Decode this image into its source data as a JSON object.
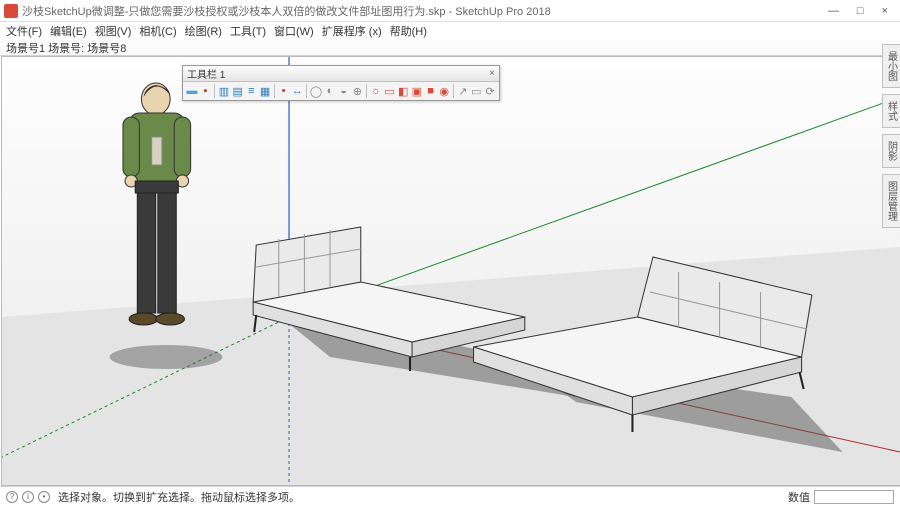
{
  "window": {
    "title": "沙枝SketchUp微调整-只做您需要沙枝授权或沙枝本人双倍的做改文件部址图用行为.skp - SketchUp Pro 2018",
    "min": "—",
    "max": "□",
    "close": "×"
  },
  "menu": {
    "items": [
      "文件(F)",
      "编辑(E)",
      "视图(V)",
      "相机(C)",
      "绘图(R)",
      "工具(T)",
      "窗口(W)",
      "扩展程序 (x)",
      "帮助(H)"
    ]
  },
  "scene": {
    "label": "场景号1  场景号:  场景号8"
  },
  "toolbar": {
    "title": "工具栏 1",
    "close": "×",
    "icons": [
      {
        "name": "tool-a",
        "color": "#4aa3df",
        "glyph": "▬"
      },
      {
        "name": "tool-b",
        "color": "#c33",
        "glyph": "▪"
      },
      {
        "sep": true
      },
      {
        "name": "tool-c",
        "color": "#2a7dbb",
        "glyph": "▥"
      },
      {
        "name": "tool-d",
        "color": "#2a7dbb",
        "glyph": "▤"
      },
      {
        "name": "tool-e",
        "color": "#2a7dbb",
        "glyph": "≡"
      },
      {
        "name": "tool-f",
        "color": "#2a7dbb",
        "glyph": "▦"
      },
      {
        "sep": true
      },
      {
        "name": "tool-g",
        "color": "#c33",
        "glyph": "•"
      },
      {
        "name": "tool-h",
        "color": "#2a7dbb",
        "glyph": "↔"
      },
      {
        "sep": true
      },
      {
        "name": "tool-i",
        "color": "#888",
        "glyph": "◯"
      },
      {
        "name": "tool-j",
        "color": "#888",
        "glyph": "◐"
      },
      {
        "name": "tool-k",
        "color": "#888",
        "glyph": "◒"
      },
      {
        "name": "tool-l",
        "color": "#888",
        "glyph": "⊕"
      },
      {
        "sep": true
      },
      {
        "name": "tool-m",
        "color": "#d94a3a",
        "glyph": "☼"
      },
      {
        "name": "tool-n",
        "color": "#d94a3a",
        "glyph": "▭"
      },
      {
        "name": "tool-o",
        "color": "#d94a3a",
        "glyph": "◧"
      },
      {
        "name": "tool-p",
        "color": "#d94a3a",
        "glyph": "▣"
      },
      {
        "name": "tool-q",
        "color": "#d94a3a",
        "glyph": "■"
      },
      {
        "name": "tool-r",
        "color": "#d94a3a",
        "glyph": "◉"
      },
      {
        "sep": true
      },
      {
        "name": "tool-s",
        "color": "#888",
        "glyph": "↗"
      },
      {
        "name": "tool-t",
        "color": "#888",
        "glyph": "▭"
      },
      {
        "name": "tool-u",
        "color": "#888",
        "glyph": "⟳"
      }
    ]
  },
  "tray": {
    "tabs": [
      "最小图",
      "样式",
      "阴影",
      "图层管理"
    ]
  },
  "status": {
    "hint": "选择对象。切换到扩充选择。拖动鼠标选择多项。",
    "measure_label": "数值"
  }
}
